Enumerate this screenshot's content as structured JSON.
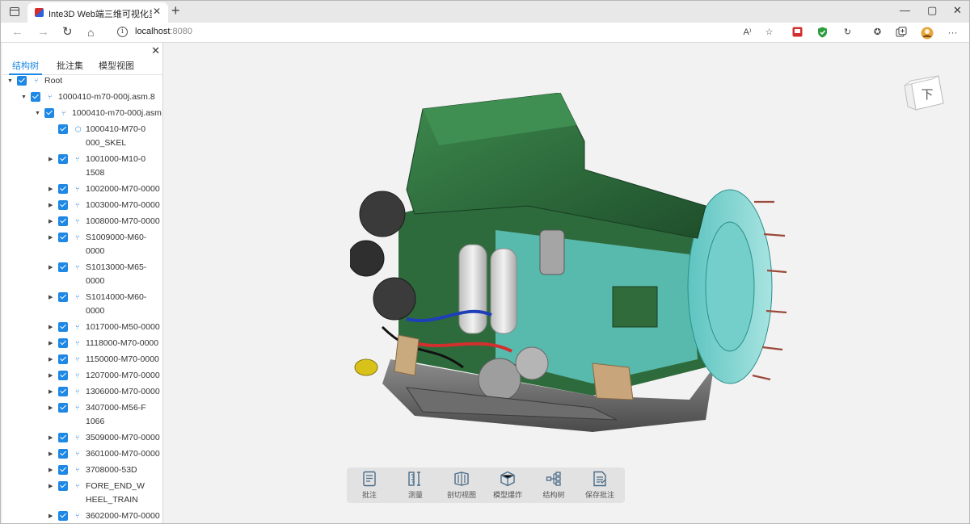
{
  "browser": {
    "tab_title": "Inte3D Web端三维可视化显示",
    "tab_close": "✕",
    "new_tab": "+",
    "url_host": "localhost",
    "url_port": ":8080",
    "window_controls": [
      "—",
      "▢",
      "✕"
    ],
    "toolbar_icons": [
      "read-aloud-icon",
      "favorite-add-icon",
      "extension-red-icon",
      "shield-green-icon",
      "refresh-circle-icon",
      "favorites-icon",
      "collections-icon",
      "profile-avatar-icon",
      "more-icon"
    ],
    "more_label": "···",
    "read_aloud_label": "A⁾"
  },
  "sidebar": {
    "close": "✕",
    "tabs": [
      {
        "label": "结构树",
        "active": true
      },
      {
        "label": "批注集",
        "active": false
      },
      {
        "label": "模型视图",
        "active": false
      }
    ],
    "tree": [
      {
        "label": "Root",
        "level": 0,
        "expanded": true,
        "caret": true,
        "icon": "assembly-icon"
      },
      {
        "label": "1000410-m70-000j.asm.8",
        "level": 1,
        "expanded": true,
        "caret": true,
        "icon": "assembly-icon"
      },
      {
        "label": "1000410-m70-000j.asm",
        "level": 2,
        "expanded": true,
        "caret": true,
        "icon": "assembly-icon"
      },
      {
        "label": "1000410-M70-0000_SKEL",
        "level": 3,
        "caret": false,
        "icon": "part-icon"
      },
      {
        "label": "1001000-M10-01508",
        "level": 3,
        "caret": true,
        "icon": "assembly-icon"
      },
      {
        "label": "1002000-M70-0000",
        "level": 3,
        "caret": true,
        "icon": "assembly-icon"
      },
      {
        "label": "1003000-M70-0000",
        "level": 3,
        "caret": true,
        "icon": "assembly-icon"
      },
      {
        "label": "1008000-M70-0000",
        "level": 3,
        "caret": true,
        "icon": "assembly-icon"
      },
      {
        "label": "S1009000-M60-0000",
        "level": 3,
        "caret": true,
        "icon": "assembly-icon"
      },
      {
        "label": "S1013000-M65-0000",
        "level": 3,
        "caret": true,
        "icon": "assembly-icon"
      },
      {
        "label": "S1014000-M60-0000",
        "level": 3,
        "caret": true,
        "icon": "assembly-icon"
      },
      {
        "label": "1017000-M50-0000",
        "level": 3,
        "caret": true,
        "icon": "assembly-icon"
      },
      {
        "label": "1118000-M70-0000",
        "level": 3,
        "caret": true,
        "icon": "assembly-icon"
      },
      {
        "label": "1150000-M70-0000",
        "level": 3,
        "caret": true,
        "icon": "assembly-icon"
      },
      {
        "label": "1207000-M70-0000",
        "level": 3,
        "caret": true,
        "icon": "assembly-icon"
      },
      {
        "label": "1306000-M70-0000",
        "level": 3,
        "caret": true,
        "icon": "assembly-icon"
      },
      {
        "label": "3407000-M56-F1066",
        "level": 3,
        "caret": true,
        "icon": "assembly-icon"
      },
      {
        "label": "3509000-M70-0000",
        "level": 3,
        "caret": true,
        "icon": "assembly-icon"
      },
      {
        "label": "3601000-M70-0000",
        "level": 3,
        "caret": true,
        "icon": "assembly-icon"
      },
      {
        "label": "3708000-53D",
        "level": 3,
        "caret": true,
        "icon": "assembly-icon"
      },
      {
        "label": "FORE_END_WHEEL_TRAIN",
        "level": 3,
        "caret": true,
        "icon": "assembly-icon"
      },
      {
        "label": "3602000-M70-0000",
        "level": 3,
        "caret": true,
        "icon": "assembly-icon"
      }
    ]
  },
  "viewport": {
    "viewcube_face": "下"
  },
  "toolbar": {
    "tools": [
      {
        "label": "批注",
        "icon": "annotation-icon"
      },
      {
        "label": "测量",
        "icon": "measure-icon"
      },
      {
        "label": "剖切视图",
        "icon": "section-view-icon"
      },
      {
        "label": "模型爆炸",
        "icon": "explode-model-icon"
      },
      {
        "label": "结构树",
        "icon": "structure-tree-icon"
      },
      {
        "label": "保存批注",
        "icon": "save-annotation-icon"
      }
    ]
  },
  "colors": {
    "accent": "#1e88e5",
    "engine_green": "#2e6b3c",
    "bellhousing_cyan": "#7fd4d0",
    "toolbar_bg": "#e2e2e2"
  }
}
